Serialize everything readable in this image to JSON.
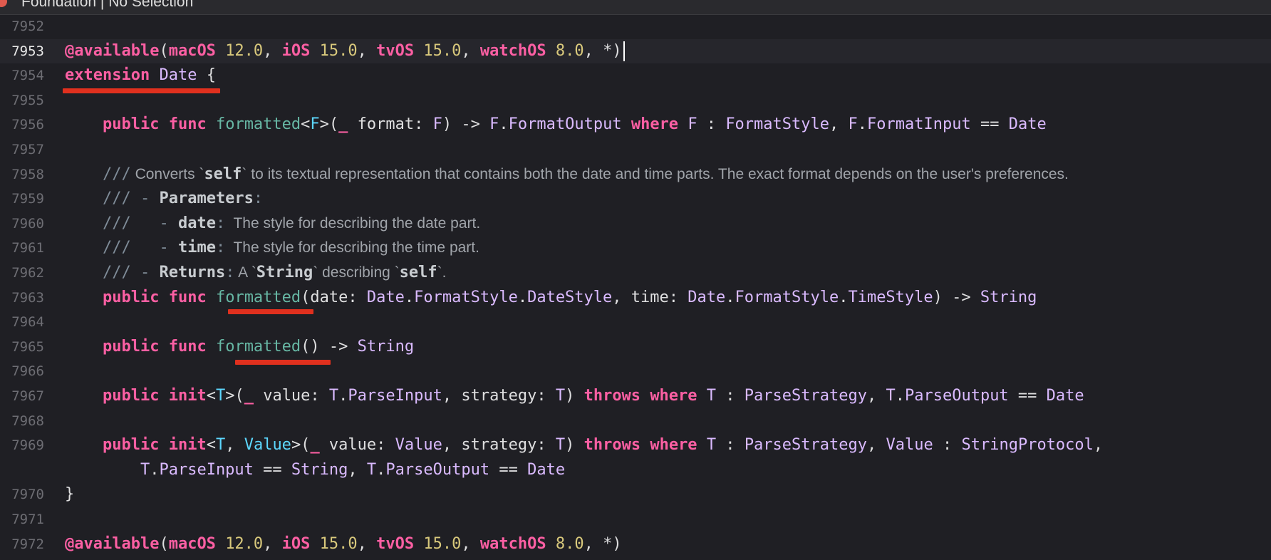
{
  "window": {
    "breadcrumb": "Foundation  |  No Selection"
  },
  "colors": {
    "background": "#1f1f24",
    "keyword": "#fc5fa3",
    "number": "#d9c97c",
    "function": "#67b7a4",
    "type": "#dabaff",
    "comment": "#7f8c98",
    "annotation_underline": "#e0301e"
  },
  "current_line": "7953",
  "lines": [
    {
      "n": "7952",
      "tokens": []
    },
    {
      "n": "7953",
      "tokens": [
        {
          "t": "@available",
          "c": "attr"
        },
        {
          "t": "(",
          "c": "def"
        },
        {
          "t": "macOS",
          "c": "kw"
        },
        {
          "t": " ",
          "c": "def"
        },
        {
          "t": "12.0",
          "c": "num"
        },
        {
          "t": ", ",
          "c": "def"
        },
        {
          "t": "iOS",
          "c": "kw"
        },
        {
          "t": " ",
          "c": "def"
        },
        {
          "t": "15.0",
          "c": "num"
        },
        {
          "t": ", ",
          "c": "def"
        },
        {
          "t": "tvOS",
          "c": "kw"
        },
        {
          "t": " ",
          "c": "def"
        },
        {
          "t": "15.0",
          "c": "num"
        },
        {
          "t": ", ",
          "c": "def"
        },
        {
          "t": "watchOS",
          "c": "kw"
        },
        {
          "t": " ",
          "c": "def"
        },
        {
          "t": "8.0",
          "c": "num"
        },
        {
          "t": ", *)",
          "c": "def"
        }
      ]
    },
    {
      "n": "7954",
      "tokens": [
        {
          "t": "extension",
          "c": "kw"
        },
        {
          "t": " ",
          "c": "def"
        },
        {
          "t": "Date",
          "c": "ty"
        },
        {
          "t": " {",
          "c": "def"
        }
      ]
    },
    {
      "n": "7955",
      "tokens": []
    },
    {
      "n": "7956",
      "tokens": [
        {
          "t": "    ",
          "c": "def"
        },
        {
          "t": "public",
          "c": "kw"
        },
        {
          "t": " ",
          "c": "def"
        },
        {
          "t": "func",
          "c": "kw"
        },
        {
          "t": " ",
          "c": "def"
        },
        {
          "t": "formatted",
          "c": "fn"
        },
        {
          "t": "<",
          "c": "def"
        },
        {
          "t": "F",
          "c": "ty2"
        },
        {
          "t": ">(",
          "c": "def"
        },
        {
          "t": "_",
          "c": "kw"
        },
        {
          "t": " format: ",
          "c": "def"
        },
        {
          "t": "F",
          "c": "ty"
        },
        {
          "t": ") -> ",
          "c": "def"
        },
        {
          "t": "F",
          "c": "ty"
        },
        {
          "t": ".",
          "c": "def"
        },
        {
          "t": "FormatOutput",
          "c": "ty"
        },
        {
          "t": " ",
          "c": "def"
        },
        {
          "t": "where",
          "c": "kw"
        },
        {
          "t": " ",
          "c": "def"
        },
        {
          "t": "F",
          "c": "ty"
        },
        {
          "t": " : ",
          "c": "def"
        },
        {
          "t": "FormatStyle",
          "c": "ty"
        },
        {
          "t": ", ",
          "c": "def"
        },
        {
          "t": "F",
          "c": "ty"
        },
        {
          "t": ".",
          "c": "def"
        },
        {
          "t": "FormatInput",
          "c": "ty"
        },
        {
          "t": " == ",
          "c": "def"
        },
        {
          "t": "Date",
          "c": "ty"
        }
      ]
    },
    {
      "n": "7957",
      "tokens": []
    },
    {
      "n": "7958",
      "tokens": [
        {
          "t": "    ",
          "c": "def"
        },
        {
          "t": "///",
          "c": "cm"
        },
        {
          "t": " Converts `",
          "c": "cmp"
        },
        {
          "t": "self",
          "c": "cmb"
        },
        {
          "t": "` to its textual representation that contains both the date and time parts. The exact format depends on the user's preferences.",
          "c": "cmp"
        }
      ]
    },
    {
      "n": "7959",
      "tokens": [
        {
          "t": "    ",
          "c": "def"
        },
        {
          "t": "/// - ",
          "c": "cm"
        },
        {
          "t": "Parameters",
          "c": "cmb"
        },
        {
          "t": ":",
          "c": "cm"
        }
      ]
    },
    {
      "n": "7960",
      "tokens": [
        {
          "t": "    ",
          "c": "def"
        },
        {
          "t": "///   - ",
          "c": "cm"
        },
        {
          "t": "date",
          "c": "cmb"
        },
        {
          "t": ":",
          "c": "cm"
        },
        {
          "t": "  The style for describing the date part.",
          "c": "cmp"
        }
      ]
    },
    {
      "n": "7961",
      "tokens": [
        {
          "t": "    ",
          "c": "def"
        },
        {
          "t": "///   - ",
          "c": "cm"
        },
        {
          "t": "time",
          "c": "cmb"
        },
        {
          "t": ":",
          "c": "cm"
        },
        {
          "t": "  The style for describing the time part.",
          "c": "cmp"
        }
      ]
    },
    {
      "n": "7962",
      "tokens": [
        {
          "t": "    ",
          "c": "def"
        },
        {
          "t": "/// - ",
          "c": "cm"
        },
        {
          "t": "Returns",
          "c": "cmb"
        },
        {
          "t": ":",
          "c": "cm"
        },
        {
          "t": " A `",
          "c": "cmp"
        },
        {
          "t": "String",
          "c": "cmb"
        },
        {
          "t": "` describing `",
          "c": "cmp"
        },
        {
          "t": "self",
          "c": "cmb"
        },
        {
          "t": "`.",
          "c": "cmp"
        }
      ]
    },
    {
      "n": "7963",
      "tokens": [
        {
          "t": "    ",
          "c": "def"
        },
        {
          "t": "public",
          "c": "kw"
        },
        {
          "t": " ",
          "c": "def"
        },
        {
          "t": "func",
          "c": "kw"
        },
        {
          "t": " ",
          "c": "def"
        },
        {
          "t": "formatted",
          "c": "fn"
        },
        {
          "t": "(date: ",
          "c": "def"
        },
        {
          "t": "Date",
          "c": "ty"
        },
        {
          "t": ".",
          "c": "def"
        },
        {
          "t": "FormatStyle",
          "c": "ty"
        },
        {
          "t": ".",
          "c": "def"
        },
        {
          "t": "DateStyle",
          "c": "ty"
        },
        {
          "t": ", time: ",
          "c": "def"
        },
        {
          "t": "Date",
          "c": "ty"
        },
        {
          "t": ".",
          "c": "def"
        },
        {
          "t": "FormatStyle",
          "c": "ty"
        },
        {
          "t": ".",
          "c": "def"
        },
        {
          "t": "TimeStyle",
          "c": "ty"
        },
        {
          "t": ") -> ",
          "c": "def"
        },
        {
          "t": "String",
          "c": "ty"
        }
      ]
    },
    {
      "n": "7964",
      "tokens": []
    },
    {
      "n": "7965",
      "tokens": [
        {
          "t": "    ",
          "c": "def"
        },
        {
          "t": "public",
          "c": "kw"
        },
        {
          "t": " ",
          "c": "def"
        },
        {
          "t": "func",
          "c": "kw"
        },
        {
          "t": " ",
          "c": "def"
        },
        {
          "t": "formatted",
          "c": "fn"
        },
        {
          "t": "() -> ",
          "c": "def"
        },
        {
          "t": "String",
          "c": "ty"
        }
      ]
    },
    {
      "n": "7966",
      "tokens": []
    },
    {
      "n": "7967",
      "tokens": [
        {
          "t": "    ",
          "c": "def"
        },
        {
          "t": "public",
          "c": "kw"
        },
        {
          "t": " ",
          "c": "def"
        },
        {
          "t": "init",
          "c": "kw"
        },
        {
          "t": "<",
          "c": "def"
        },
        {
          "t": "T",
          "c": "ty2"
        },
        {
          "t": ">(",
          "c": "def"
        },
        {
          "t": "_",
          "c": "kw"
        },
        {
          "t": " value: ",
          "c": "def"
        },
        {
          "t": "T",
          "c": "ty"
        },
        {
          "t": ".",
          "c": "def"
        },
        {
          "t": "ParseInput",
          "c": "ty"
        },
        {
          "t": ", strategy: ",
          "c": "def"
        },
        {
          "t": "T",
          "c": "ty"
        },
        {
          "t": ") ",
          "c": "def"
        },
        {
          "t": "throws",
          "c": "kw"
        },
        {
          "t": " ",
          "c": "def"
        },
        {
          "t": "where",
          "c": "kw"
        },
        {
          "t": " ",
          "c": "def"
        },
        {
          "t": "T",
          "c": "ty"
        },
        {
          "t": " : ",
          "c": "def"
        },
        {
          "t": "ParseStrategy",
          "c": "ty"
        },
        {
          "t": ", ",
          "c": "def"
        },
        {
          "t": "T",
          "c": "ty"
        },
        {
          "t": ".",
          "c": "def"
        },
        {
          "t": "ParseOutput",
          "c": "ty"
        },
        {
          "t": " == ",
          "c": "def"
        },
        {
          "t": "Date",
          "c": "ty"
        }
      ]
    },
    {
      "n": "7968",
      "tokens": []
    },
    {
      "n": "7969",
      "tokens": [
        {
          "t": "    ",
          "c": "def"
        },
        {
          "t": "public",
          "c": "kw"
        },
        {
          "t": " ",
          "c": "def"
        },
        {
          "t": "init",
          "c": "kw"
        },
        {
          "t": "<",
          "c": "def"
        },
        {
          "t": "T",
          "c": "ty2"
        },
        {
          "t": ", ",
          "c": "def"
        },
        {
          "t": "Value",
          "c": "ty2"
        },
        {
          "t": ">(",
          "c": "def"
        },
        {
          "t": "_",
          "c": "kw"
        },
        {
          "t": " value: ",
          "c": "def"
        },
        {
          "t": "Value",
          "c": "ty"
        },
        {
          "t": ", strategy: ",
          "c": "def"
        },
        {
          "t": "T",
          "c": "ty"
        },
        {
          "t": ") ",
          "c": "def"
        },
        {
          "t": "throws",
          "c": "kw"
        },
        {
          "t": " ",
          "c": "def"
        },
        {
          "t": "where",
          "c": "kw"
        },
        {
          "t": " ",
          "c": "def"
        },
        {
          "t": "T",
          "c": "ty"
        },
        {
          "t": " : ",
          "c": "def"
        },
        {
          "t": "ParseStrategy",
          "c": "ty"
        },
        {
          "t": ", ",
          "c": "def"
        },
        {
          "t": "Value",
          "c": "ty"
        },
        {
          "t": " : ",
          "c": "def"
        },
        {
          "t": "StringProtocol",
          "c": "ty"
        },
        {
          "t": ",",
          "c": "def"
        }
      ]
    },
    {
      "n": "",
      "tokens": [
        {
          "t": "        ",
          "c": "def"
        },
        {
          "t": "T",
          "c": "ty"
        },
        {
          "t": ".",
          "c": "def"
        },
        {
          "t": "ParseInput",
          "c": "ty"
        },
        {
          "t": " == ",
          "c": "def"
        },
        {
          "t": "String",
          "c": "ty"
        },
        {
          "t": ", ",
          "c": "def"
        },
        {
          "t": "T",
          "c": "ty"
        },
        {
          "t": ".",
          "c": "def"
        },
        {
          "t": "ParseOutput",
          "c": "ty"
        },
        {
          "t": " == ",
          "c": "def"
        },
        {
          "t": "Date",
          "c": "ty"
        }
      ]
    },
    {
      "n": "7970",
      "tokens": [
        {
          "t": "}",
          "c": "def"
        }
      ]
    },
    {
      "n": "7971",
      "tokens": []
    },
    {
      "n": "7972",
      "tokens": [
        {
          "t": "@available",
          "c": "attr"
        },
        {
          "t": "(",
          "c": "def"
        },
        {
          "t": "macOS",
          "c": "kw"
        },
        {
          "t": " ",
          "c": "def"
        },
        {
          "t": "12.0",
          "c": "num"
        },
        {
          "t": ", ",
          "c": "def"
        },
        {
          "t": "iOS",
          "c": "kw"
        },
        {
          "t": " ",
          "c": "def"
        },
        {
          "t": "15.0",
          "c": "num"
        },
        {
          "t": ", ",
          "c": "def"
        },
        {
          "t": "tvOS",
          "c": "kw"
        },
        {
          "t": " ",
          "c": "def"
        },
        {
          "t": "15.0",
          "c": "num"
        },
        {
          "t": ", ",
          "c": "def"
        },
        {
          "t": "watchOS",
          "c": "kw"
        },
        {
          "t": " ",
          "c": "def"
        },
        {
          "t": "8.0",
          "c": "num"
        },
        {
          "t": ", *)",
          "c": "def"
        }
      ]
    }
  ]
}
